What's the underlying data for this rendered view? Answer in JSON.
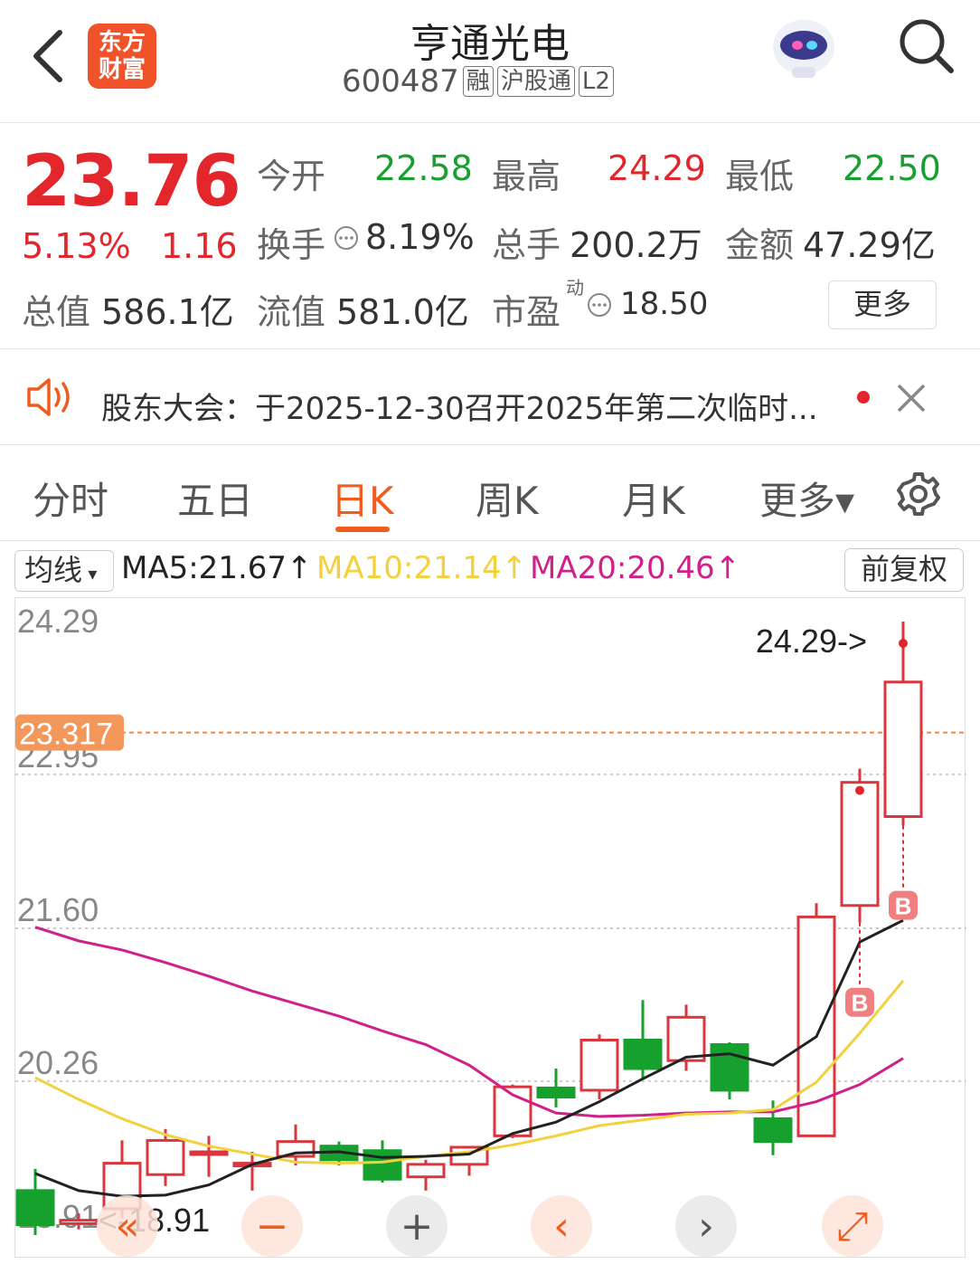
{
  "header": {
    "logo_line1": "东方",
    "logo_line2": "财富",
    "title": "亨通光电",
    "code": "600487",
    "tags": [
      "融",
      "沪股通",
      "L2"
    ]
  },
  "quote": {
    "price": "23.76",
    "change_pct": "5.13%",
    "change": "1.16",
    "open_label": "今开",
    "open": "22.58",
    "high_label": "最高",
    "high": "24.29",
    "low_label": "最低",
    "low": "22.50",
    "turnover_label": "换手",
    "turnover": "8.19%",
    "volume_label": "总手",
    "volume": "200.2万",
    "amount_label": "金额",
    "amount": "47.29亿",
    "mktcap_label": "总值",
    "mktcap": "586.1亿",
    "float_label": "流值",
    "float": "581.0亿",
    "pe_label": "市盈",
    "pe_sup": "动",
    "pe": "18.50",
    "more": "更多"
  },
  "notice": {
    "text": "股东大会：于2025-12-30召开2025年第二次临时..."
  },
  "tabs": [
    "分时",
    "五日",
    "日K",
    "周K",
    "月K",
    "更多▾"
  ],
  "active_tab": "日K",
  "ma_bar": {
    "select": "均线",
    "ma5": "MA5:21.67↑",
    "ma10": "MA10:21.14↑",
    "ma20": "MA20:20.46↑",
    "fuquan": "前复权",
    "ma5_color": "#222222",
    "ma10_color": "#f2d13c",
    "ma20_color": "#d0208a"
  },
  "chart_data": {
    "type": "candlestick",
    "y_ticks": [
      "24.29",
      "22.95",
      "21.60",
      "20.26",
      "18.91"
    ],
    "ylim": [
      18.91,
      24.29
    ],
    "crosshair_price": "23.317",
    "max_label": "24.29->",
    "min_label": "<-18.91",
    "up_color": "#d9363e",
    "down_color": "#16a12e",
    "candles": [
      {
        "o": 19.3,
        "h": 19.49,
        "l": 18.91,
        "c": 19.0
      },
      {
        "o": 19.01,
        "h": 19.1,
        "l": 18.96,
        "c": 19.04
      },
      {
        "o": 19.14,
        "h": 19.74,
        "l": 19.06,
        "c": 19.54
      },
      {
        "o": 19.44,
        "h": 19.84,
        "l": 19.34,
        "c": 19.74
      },
      {
        "o": 19.64,
        "h": 19.78,
        "l": 19.42,
        "c": 19.64
      },
      {
        "o": 19.54,
        "h": 19.64,
        "l": 19.3,
        "c": 19.54
      },
      {
        "o": 19.6,
        "h": 19.88,
        "l": 19.52,
        "c": 19.73
      },
      {
        "o": 19.69,
        "h": 19.73,
        "l": 19.52,
        "c": 19.57
      },
      {
        "o": 19.65,
        "h": 19.74,
        "l": 19.37,
        "c": 19.4
      },
      {
        "o": 19.42,
        "h": 19.57,
        "l": 19.3,
        "c": 19.53
      },
      {
        "o": 19.53,
        "h": 19.68,
        "l": 19.43,
        "c": 19.68
      },
      {
        "o": 19.78,
        "h": 20.23,
        "l": 19.76,
        "c": 20.21
      },
      {
        "o": 20.2,
        "h": 20.37,
        "l": 20.03,
        "c": 20.12
      },
      {
        "o": 20.18,
        "h": 20.67,
        "l": 20.1,
        "c": 20.62
      },
      {
        "o": 20.62,
        "h": 20.97,
        "l": 20.28,
        "c": 20.37
      },
      {
        "o": 20.44,
        "h": 20.93,
        "l": 20.35,
        "c": 20.82
      },
      {
        "o": 20.58,
        "h": 20.6,
        "l": 20.1,
        "c": 20.18
      },
      {
        "o": 19.93,
        "h": 20.09,
        "l": 19.61,
        "c": 19.73
      },
      {
        "o": 19.78,
        "h": 21.82,
        "l": 19.78,
        "c": 21.7
      },
      {
        "o": 21.8,
        "h": 23.0,
        "l": 21.65,
        "c": 22.88
      },
      {
        "o": 22.58,
        "h": 24.29,
        "l": 22.5,
        "c": 23.76
      }
    ],
    "ma5": [
      19.45,
      19.3,
      19.25,
      19.26,
      19.35,
      19.53,
      19.63,
      19.64,
      19.59,
      19.6,
      19.62,
      19.8,
      19.9,
      20.08,
      20.28,
      20.47,
      20.5,
      20.4,
      20.65,
      21.48,
      21.67
    ],
    "ma10": [
      20.29,
      20.1,
      19.93,
      19.79,
      19.69,
      19.62,
      19.55,
      19.54,
      19.55,
      19.6,
      19.64,
      19.7,
      19.78,
      19.87,
      19.92,
      19.97,
      19.98,
      20.01,
      20.25,
      20.68,
      21.14
    ],
    "ma20": [
      21.61,
      21.49,
      21.41,
      21.3,
      21.18,
      21.05,
      20.94,
      20.83,
      20.7,
      20.58,
      20.4,
      20.14,
      19.98,
      19.95,
      19.96,
      19.98,
      19.99,
      19.99,
      20.08,
      20.23,
      20.46
    ],
    "buy_marks": [
      19,
      20
    ],
    "buy_label": "B",
    "controls": [
      "«",
      "−",
      "+",
      "‹",
      "›",
      "⤢"
    ]
  }
}
